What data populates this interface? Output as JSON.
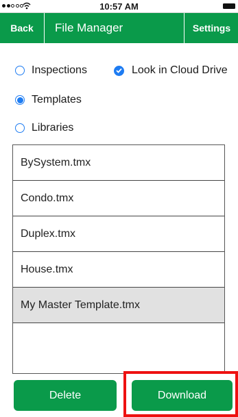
{
  "status_bar": {
    "time": "10:57 AM",
    "signal_icon": "signal-dots-icon",
    "wifi_icon": "wifi-icon",
    "battery_icon": "battery-icon"
  },
  "nav": {
    "back_label": "Back",
    "title": "File Manager",
    "settings_label": "Settings",
    "color": "#0a9a4a"
  },
  "filters": {
    "inspections_label": "Inspections",
    "inspections_selected": false,
    "cloud_label": "Look in Cloud Drive",
    "cloud_checked": true,
    "templates_label": "Templates",
    "templates_selected": true,
    "libraries_label": "Libraries",
    "libraries_selected": false
  },
  "files": [
    {
      "name": "BySystem.tmx"
    },
    {
      "name": "Condo.tmx"
    },
    {
      "name": "Duplex.tmx"
    },
    {
      "name": "House.tmx"
    },
    {
      "name": "My Master Template.tmx",
      "selected": true
    }
  ],
  "actions": {
    "delete_label": "Delete",
    "download_label": "Download"
  },
  "colors": {
    "accent_green": "#0a9a4a",
    "radio_blue": "#1e7cf2",
    "highlight_red": "#ee1111",
    "selected_row": "#e1e1e1"
  }
}
